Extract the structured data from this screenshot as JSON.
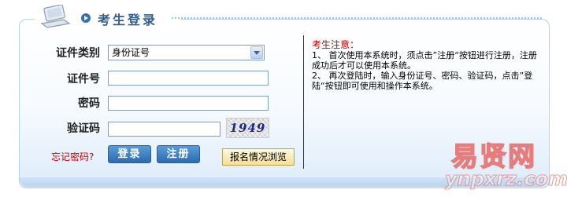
{
  "header": {
    "title": "考生登录"
  },
  "form": {
    "id_type_label": "证件类别",
    "id_type_value": "身份证号",
    "id_number_label": "证件号",
    "id_number_value": "",
    "password_label": "密码",
    "password_value": "",
    "captcha_label": "验证码",
    "captcha_value": "",
    "captcha_image_text": "1949",
    "forgot_password": "忘记密码?",
    "login_button": "登录",
    "register_button": "注册",
    "browse_button": "报名情况浏览"
  },
  "notice": {
    "title": "考生注意：",
    "item1": "1、 首次使用本系统时，须点击”注册“按钮进行注册，注册成功后才可以使用本系统。",
    "item2": "2、 再次登陆时，输入身份证号、密码、验证码，点击”登陆“按钮即可使用和操作本系统。"
  },
  "watermark": {
    "cn": "易贤网",
    "en": "ynpxrz.com"
  },
  "colors": {
    "title": "#2f5e8f",
    "button_blue": "#2a6cb3",
    "notice_title": "#cc0000",
    "forgot_link": "#cc0000",
    "panel_border": "#b7d0e8"
  }
}
